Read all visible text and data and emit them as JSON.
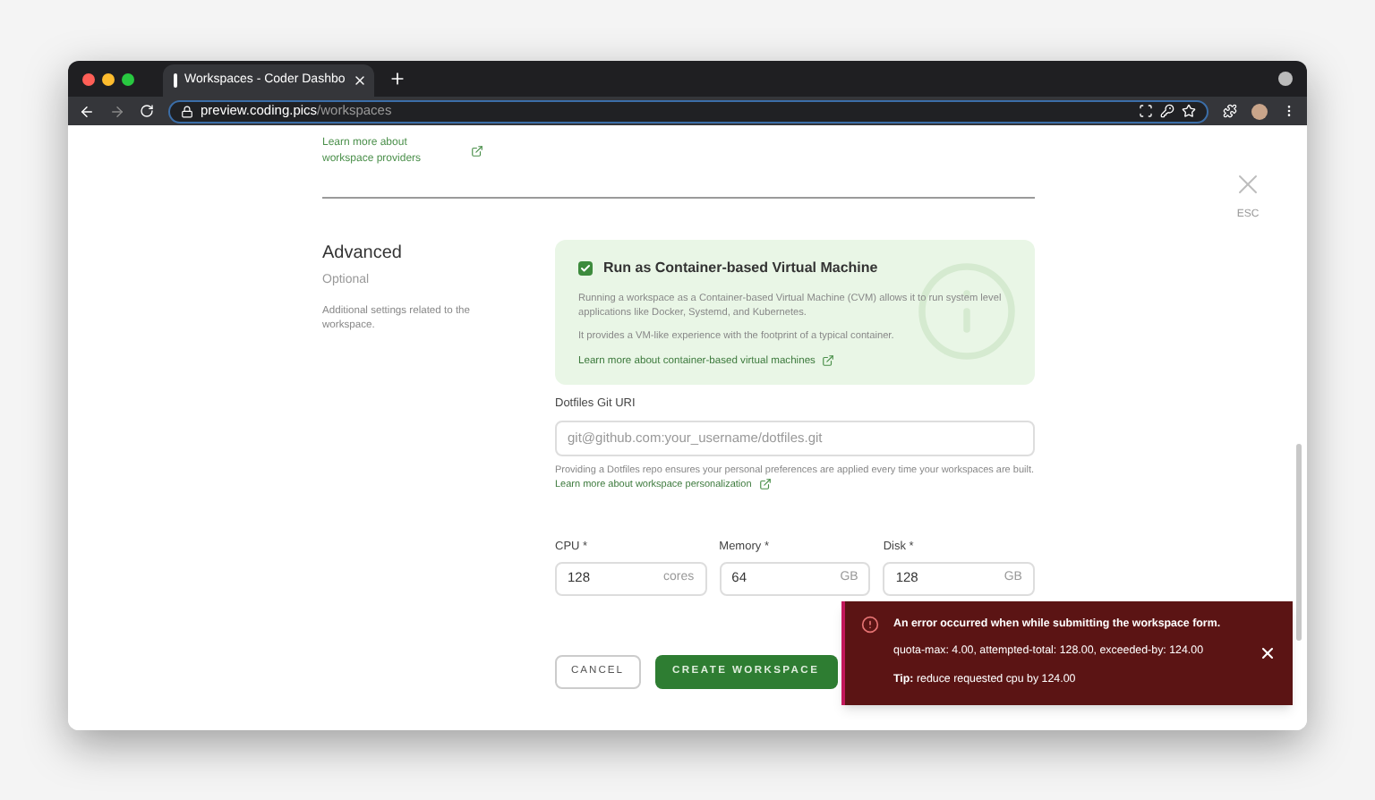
{
  "browser": {
    "tab_title": "Workspaces - Coder Dashbo",
    "url_host": "preview.coding.pics",
    "url_path": "/workspaces"
  },
  "providers_link": "Learn more about workspace providers",
  "close": {
    "label": "ESC"
  },
  "advanced": {
    "title": "Advanced",
    "subtitle": "Optional",
    "description": "Additional settings related to the workspace."
  },
  "cvm": {
    "label": "Run as Container-based Virtual Machine",
    "checked": true,
    "text_1": "Running a workspace as a Container-based Virtual Machine (CVM) allows it to run system level applications like Docker, Systemd, and Kubernetes.",
    "text_2": "It provides a VM-like experience with the footprint of a typical container.",
    "link": "Learn more about container-based virtual machines"
  },
  "dotfiles": {
    "label": "Dotfiles Git URI",
    "placeholder": "git@github.com:your_username/dotfiles.git",
    "help": "Providing a Dotfiles repo ensures your personal preferences are applied every time your workspaces are built.",
    "link": "Learn more about workspace personalization"
  },
  "resources": [
    {
      "label": "CPU",
      "required_mark": "*",
      "value": "128",
      "unit": "cores"
    },
    {
      "label": "Memory",
      "required_mark": "*",
      "value": "64",
      "unit": "GB"
    },
    {
      "label": "Disk",
      "required_mark": "*",
      "value": "128",
      "unit": "GB"
    }
  ],
  "buttons": {
    "cancel": "CANCEL",
    "create": "CREATE WORKSPACE"
  },
  "toast": {
    "title": "An error occurred when while submitting the workspace form.",
    "detail": "quota-max: 4.00, attempted-total: 128.00, exceeded-by: 124.00",
    "tip": "**Tip:** reduce requested cpu by 124.00"
  }
}
